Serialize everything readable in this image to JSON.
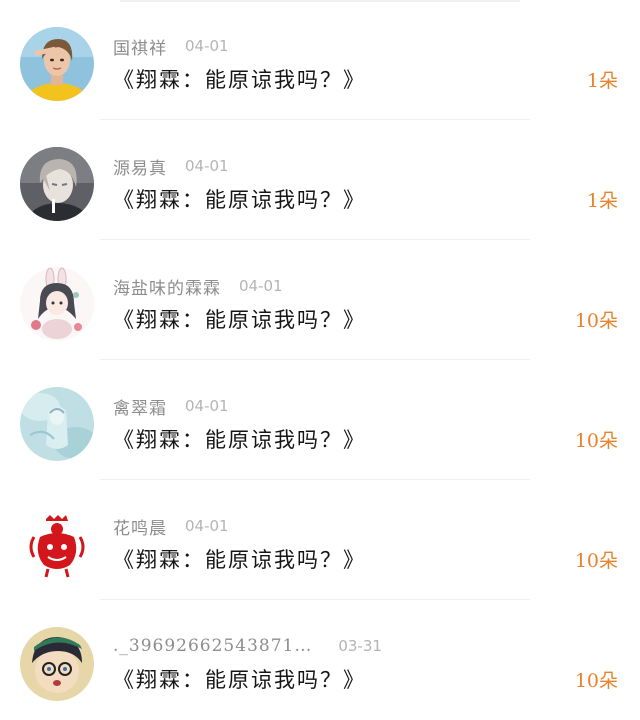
{
  "rows": [
    {
      "username": "国祺祥",
      "date": "04-01",
      "message": "《翔霖：能原谅我吗？》",
      "count": "1朵",
      "avatar_icon": "girl-portrait-yellow-avatar"
    },
    {
      "username": "源易真",
      "date": "04-01",
      "message": "《翔霖：能原谅我吗？》",
      "count": "1朵",
      "avatar_icon": "anime-boy-avatar"
    },
    {
      "username": "海盐味的霖霖",
      "date": "04-01",
      "message": "《翔霖：能原谅我吗？》",
      "count": "10朵",
      "avatar_icon": "bunny-ear-girl-illustration-avatar"
    },
    {
      "username": "禽翠霜",
      "date": "04-01",
      "message": "《翔霖：能原谅我吗？》",
      "count": "10朵",
      "avatar_icon": "pale-blue-painting-avatar"
    },
    {
      "username": "花鸣晨",
      "date": "04-01",
      "message": "《翔霖：能原谅我吗？》",
      "count": "10朵",
      "avatar_icon": "red-paper-cut-rooster-avatar"
    },
    {
      "username": "._39692662543871…",
      "date": "03-31",
      "message": "《翔霖：能原谅我吗？》",
      "count": "10朵",
      "avatar_icon": "anime-detective-boy-avatar"
    }
  ],
  "colors": {
    "count_accent": "#e8822c",
    "username": "#8d8d8d",
    "date": "#b4b4b4",
    "message": "#151515"
  }
}
